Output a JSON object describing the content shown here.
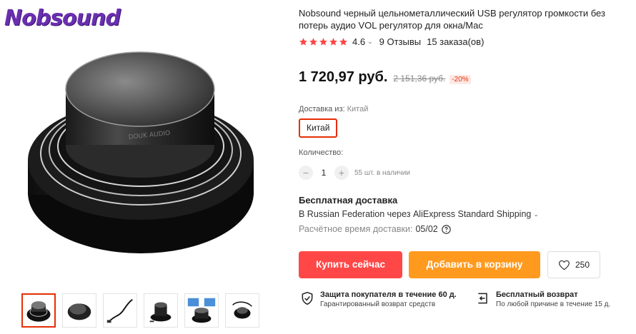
{
  "brand": {
    "logo_text": "Nobsound"
  },
  "gallery": {
    "main_image": "black-usb-volume-knob-controller",
    "thumbnails": [
      {
        "name": "knob-front",
        "active": true
      },
      {
        "name": "knob-top",
        "active": false
      },
      {
        "name": "knob-cable",
        "active": false
      },
      {
        "name": "knob-side",
        "active": false
      },
      {
        "name": "knob-box",
        "active": false
      },
      {
        "name": "knob-with-cable",
        "active": false
      }
    ]
  },
  "product": {
    "title": "Nobsound черный цельнометаллический USB регулятор громкости без потерь аудио VOL регулятор для окна/Mac",
    "rating": {
      "score": "4.6",
      "reviews": "9 Отзывы",
      "orders": "15 заказа(ов)"
    },
    "price": {
      "current": "1 720,97 руб.",
      "old": "2 151,36 руб.",
      "discount": "-20%"
    },
    "ship_from": {
      "label": "Доставка из:",
      "value": "Китай"
    },
    "country_option": "Китай",
    "quantity": {
      "label": "Количество:",
      "value": "1",
      "minus": "−",
      "plus": "+",
      "available": "55 шт. в наличии"
    },
    "shipping": {
      "title": "Бесплатная доставка",
      "method": "В Russian Federation через AliExpress Standard Shipping",
      "time_label": "Расчётное время доставки:",
      "time_value": "05/02"
    },
    "buttons": {
      "buy": "Купить сейчас",
      "cart": "Добавить в корзину",
      "wishlist_count": "250"
    },
    "guarantees": [
      {
        "icon": "shield-check-icon",
        "title": "Защита покупателя в течение 60 д.",
        "subtitle": "Гарантированный возврат средств"
      },
      {
        "icon": "return-icon",
        "title": "Бесплатный возврат",
        "subtitle": "По любой причине в течение 15 д."
      }
    ]
  },
  "colors": {
    "accent_red": "#ff4747",
    "accent_orange": "#ff9a1f",
    "star": "#ff4747",
    "brand_purple": "#6a2fb0"
  }
}
